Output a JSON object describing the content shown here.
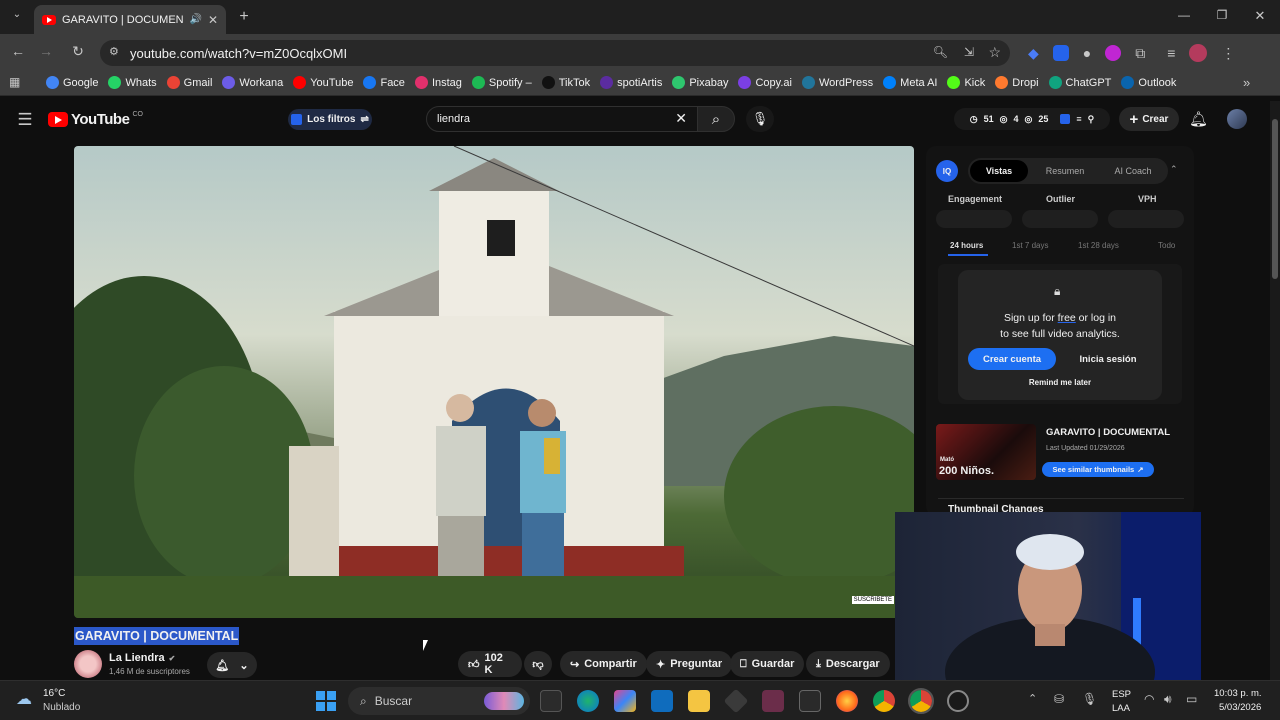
{
  "browser": {
    "tab_title": "GARAVITO | DOCUMENTAL",
    "url": "youtube.com/watch?v=mZ0OcqlxOMI",
    "bookmarks": [
      {
        "label": "Google",
        "color": "#4285f4"
      },
      {
        "label": "Whats",
        "color": "#25d366"
      },
      {
        "label": "Gmail",
        "color": "#ea4335"
      },
      {
        "label": "Workana",
        "color": "#6c5ce7"
      },
      {
        "label": "YouTube",
        "color": "#ff0000"
      },
      {
        "label": "Face",
        "color": "#1877f2"
      },
      {
        "label": "Instag",
        "color": "#e1306c"
      },
      {
        "label": "Spotify –",
        "color": "#1db954"
      },
      {
        "label": "TikTok",
        "color": "#111111"
      },
      {
        "label": "spotiArtis",
        "color": "#5b2ca0"
      },
      {
        "label": "Pixabay",
        "color": "#2ec66e"
      },
      {
        "label": "Copy.ai",
        "color": "#7b3fe4"
      },
      {
        "label": "WordPress",
        "color": "#21759b"
      },
      {
        "label": "Meta AI",
        "color": "#0081fb"
      },
      {
        "label": "Kick",
        "color": "#53fc18"
      },
      {
        "label": "Dropi",
        "color": "#ff7a2f"
      },
      {
        "label": "ChatGPT",
        "color": "#10a37f"
      },
      {
        "label": "Outlook",
        "color": "#0a64ad"
      }
    ]
  },
  "youtube": {
    "logo": "YouTube",
    "logo_sup": "CO",
    "filters_label": "Los filtros",
    "search_value": "liendra",
    "stats": {
      "a": "51",
      "b": "4",
      "c": "25"
    },
    "create_label": "Crear",
    "video_title": "GARAVITO | DOCUMENTAL",
    "channel_name": "La Liendra",
    "subscribers": "1,46 M de suscriptores",
    "likes": "102 K",
    "share_label": "Compartir",
    "ask_label": "Preguntar",
    "save_label": "Guardar",
    "download_label": "Descargar",
    "watermark": "SUSCRIBETE"
  },
  "panel": {
    "tabs": [
      "Vistas",
      "Resumen",
      "AI Coach"
    ],
    "metrics": [
      "Engagement",
      "Outlier",
      "VPH"
    ],
    "ranges": [
      "24 hours",
      "1st 7 days",
      "1st 28 days",
      "Todo"
    ],
    "signup_pre": "Sign up for ",
    "signup_free": "free",
    "signup_post": " or log in",
    "signup_line2": "to see full video analytics.",
    "create_account": "Crear cuenta",
    "login": "Inicia sesión",
    "remind": "Remind me later",
    "thumb_title": "GARAVITO | DOCUMENTAL",
    "thumb_updated": "Last Updated 01/29/2026",
    "thumb_overlay": "200 Niños.",
    "thumb_overlay_small": "Mató",
    "similar_btn": "See similar thumbnails",
    "changes": "Thumbnail Changes"
  },
  "taskbar": {
    "temp": "16°C",
    "weather": "Nublado",
    "search": "Buscar",
    "lang1": "ESP",
    "lang2": "LAA",
    "time": "10:03 p. m.",
    "date": "5/03/2026"
  }
}
